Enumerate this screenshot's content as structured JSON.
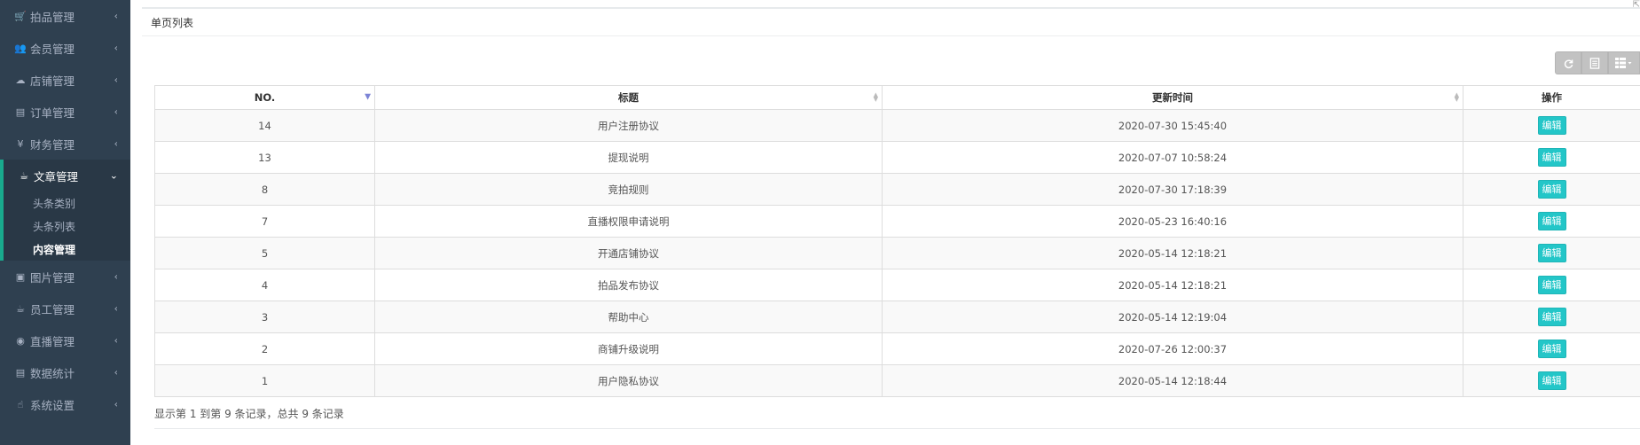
{
  "sidebar": {
    "groups_before": [
      {
        "label": "拍品管理",
        "icon": "cart-icon",
        "glyph": "🛒"
      },
      {
        "label": "会员管理",
        "icon": "users-icon",
        "glyph": "👥"
      },
      {
        "label": "店铺管理",
        "icon": "cloud-icon",
        "glyph": "☁"
      },
      {
        "label": "订单管理",
        "icon": "book-icon",
        "glyph": "▤"
      },
      {
        "label": "财务管理",
        "icon": "yen-icon",
        "glyph": "¥"
      }
    ],
    "active_group": {
      "label": "文章管理",
      "icon": "coffee-icon",
      "glyph": "☕",
      "items": [
        {
          "label": "头条类别"
        },
        {
          "label": "头条列表"
        },
        {
          "label": "内容管理"
        }
      ]
    },
    "groups_after": [
      {
        "label": "图片管理",
        "icon": "image-icon",
        "glyph": "▣"
      },
      {
        "label": "员工管理",
        "icon": "coffee-icon",
        "glyph": "☕"
      },
      {
        "label": "直播管理",
        "icon": "eye-icon",
        "glyph": "◉"
      },
      {
        "label": "数据统计",
        "icon": "book-icon",
        "glyph": "▤"
      },
      {
        "label": "系统设置",
        "icon": "hand-icon",
        "glyph": "☝"
      }
    ]
  },
  "panel": {
    "title": "单页列表"
  },
  "table": {
    "headers": [
      "NO.",
      "标题",
      "更新时间",
      "操作"
    ],
    "edit_label": "编辑",
    "rows": [
      {
        "no": "14",
        "title": "用户注册协议",
        "updated": "2020-07-30 15:45:40"
      },
      {
        "no": "13",
        "title": "提现说明",
        "updated": "2020-07-07 10:58:24"
      },
      {
        "no": "8",
        "title": "竞拍规则",
        "updated": "2020-07-30 17:18:39"
      },
      {
        "no": "7",
        "title": "直播权限申请说明",
        "updated": "2020-05-23 16:40:16"
      },
      {
        "no": "5",
        "title": "开通店铺协议",
        "updated": "2020-05-14 12:18:21"
      },
      {
        "no": "4",
        "title": "拍品发布协议",
        "updated": "2020-05-14 12:18:21"
      },
      {
        "no": "3",
        "title": "帮助中心",
        "updated": "2020-05-14 12:19:04"
      },
      {
        "no": "2",
        "title": "商铺升级说明",
        "updated": "2020-07-26 12:00:37"
      },
      {
        "no": "1",
        "title": "用户隐私协议",
        "updated": "2020-05-14 12:18:44"
      }
    ]
  },
  "footer": {
    "info": "显示第 1 到第 9 条记录，总共 9 条记录"
  },
  "colors": {
    "sidebar_bg": "#2f4050",
    "accent": "#19aa8d",
    "edit_button": "#23c6c8"
  }
}
